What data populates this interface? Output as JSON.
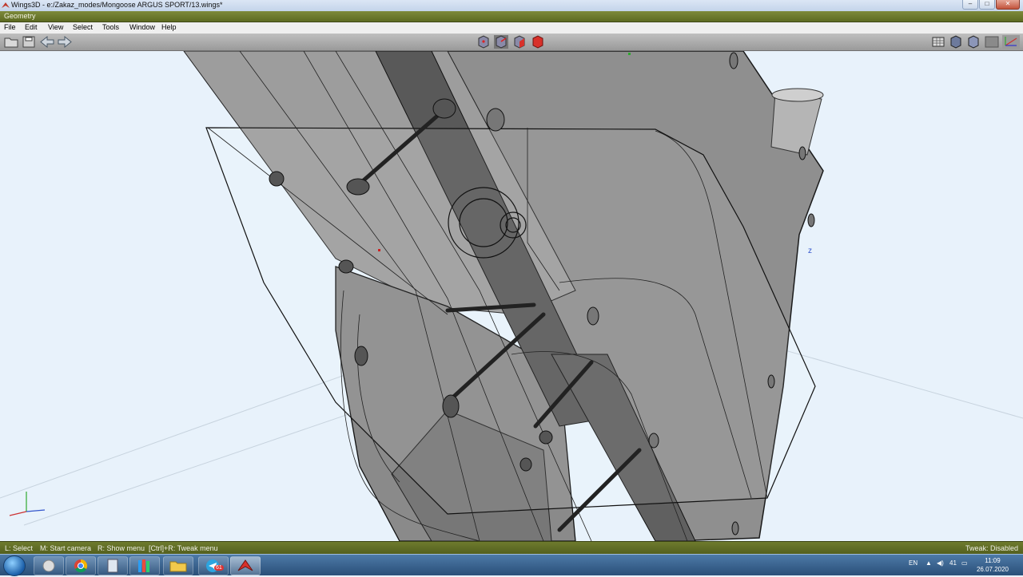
{
  "window": {
    "title": "Wings3D - e:/Zakaz_modes/Mongoose ARGUS SPORT/13.wings*",
    "controls": [
      "–",
      "□",
      "✕"
    ]
  },
  "geometry_bar": {
    "label": "Geometry"
  },
  "menu": {
    "items": [
      "File",
      "Edit",
      "View",
      "Select",
      "Tools",
      "Window",
      "Help"
    ]
  },
  "toolbar": {
    "left_icons": [
      "open-folder-icon",
      "save-icon",
      "undo-arrow-icon",
      "redo-arrow-icon"
    ],
    "selection_modes": [
      "vertex-mode-icon",
      "edge-mode-icon",
      "face-mode-icon",
      "body-mode-icon"
    ],
    "view_icons": [
      "groundplane-icon",
      "smooth-shade-icon",
      "flat-shade-icon",
      "wireframe-icon",
      "axes-icon"
    ]
  },
  "viewport": {
    "axis_label_z": "z"
  },
  "status": {
    "select": "L: Select",
    "camera": "M: Start camera",
    "menu": "R: Show menu",
    "tweak_menu": "[Ctrl]+R: Tweak menu",
    "tweak_state": "Tweak: Disabled"
  },
  "taskbar": {
    "apps": [
      "start-orb",
      "tool-icon",
      "chrome-icon",
      "calculator-icon",
      "library-icon",
      "file-explorer-icon",
      "telegram-icon",
      "wings3d-icon"
    ],
    "telegram_badge": "61",
    "lang": "EN",
    "volume_level": "41",
    "time": "11:09",
    "date": "26.07.2020"
  },
  "colors": {
    "geometry_bar": "#6b7829",
    "viewport_bg": "#e8f2fb",
    "model_gray": "#8f8f8f",
    "face_mode_red": "#d8312a"
  }
}
